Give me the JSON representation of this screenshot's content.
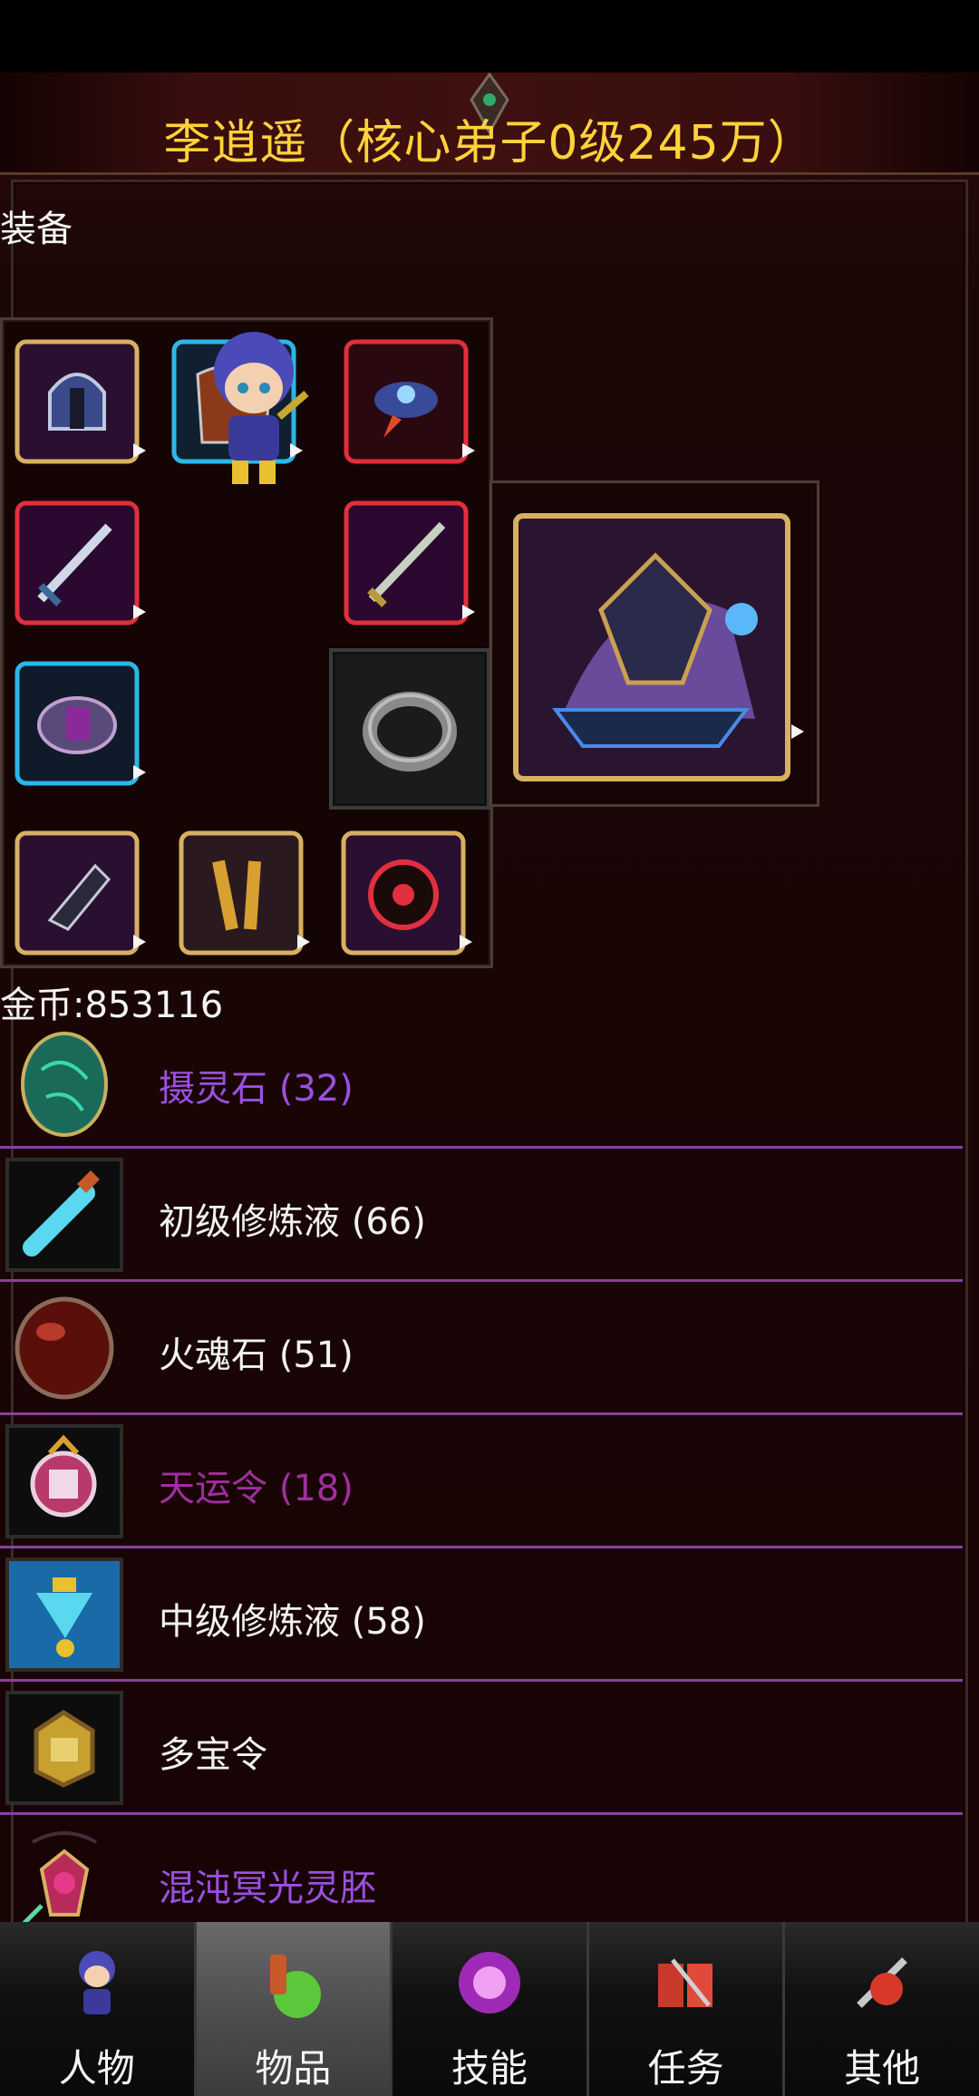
{
  "header": {
    "title": "李逍遥（核心弟子0级245万）"
  },
  "equipment": {
    "label": "装备"
  },
  "currency": {
    "gold_text": "金币:853116"
  },
  "items": [
    {
      "name": "摄灵石 (32)",
      "color": "#9b50e0",
      "icon": "green-egg-icon"
    },
    {
      "name": "初级修炼液 (66)",
      "color": "#f2f2f2",
      "icon": "potion-vial-icon"
    },
    {
      "name": "火魂石 (51)",
      "color": "#f2f2f2",
      "icon": "red-orb-icon"
    },
    {
      "name": "天运令 (18)",
      "color": "#a02ea0",
      "icon": "token-icon"
    },
    {
      "name": "中级修炼液 (58)",
      "color": "#f2f2f2",
      "icon": "flask-icon"
    },
    {
      "name": "多宝令",
      "color": "#f2f2f2",
      "icon": "gold-token-icon"
    },
    {
      "name": "混沌冥光灵胚",
      "color": "#9b50e0",
      "icon": "amulet-icon"
    }
  ],
  "tabs": [
    {
      "label": "人物",
      "icon": "character-icon",
      "active": false
    },
    {
      "label": "物品",
      "icon": "potion-bag-icon",
      "active": true
    },
    {
      "label": "技能",
      "icon": "skill-orb-icon",
      "active": false
    },
    {
      "label": "任务",
      "icon": "quest-book-icon",
      "active": false
    },
    {
      "label": "其他",
      "icon": "other-icon",
      "active": false
    }
  ]
}
